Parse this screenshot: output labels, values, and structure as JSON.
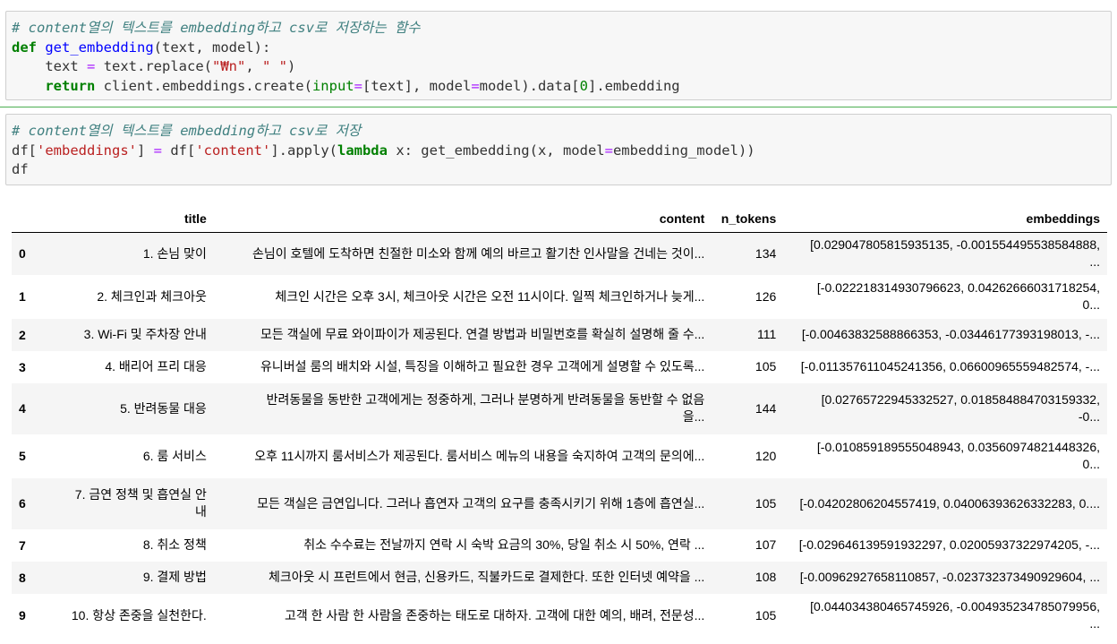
{
  "cells": {
    "cell1": {
      "comment": "# content열의 텍스트를 embedding하고 csv로 저장하는 함수",
      "def_kw": "def",
      "func_name": "get_embedding",
      "def_params": "(text, model):",
      "line2_var": "text",
      "line2_eq": "=",
      "line2_expr": "text.replace(",
      "line2_s1": "\"₩n\"",
      "line2_sep": ", ",
      "line2_s2": "\" \"",
      "line2_end": ")",
      "return_kw": "return",
      "line3_a": "client.embeddings.create(",
      "line3_kw_input": "input",
      "line3_eq1": "=",
      "line3_b": "[text], model",
      "line3_eq2": "=",
      "line3_c": "model).data[",
      "line3_zero": "0",
      "line3_d": "].embedding"
    },
    "cell2": {
      "comment": "# content열의 텍스트를 embedding하고 csv로 저장",
      "l2_a": "df[",
      "l2_s1": "'embeddings'",
      "l2_b": "] ",
      "l2_eq": "=",
      "l2_c": " df[",
      "l2_s2": "'content'",
      "l2_d": "].apply(",
      "l2_lambda": "lambda",
      "l2_e": " x: get_embedding(x, model",
      "l2_eq2": "=",
      "l2_f": "embedding_model))",
      "l3": "df"
    }
  },
  "table": {
    "columns": [
      "title",
      "content",
      "n_tokens",
      "embeddings"
    ],
    "rows": [
      {
        "idx": "0",
        "title": "1. 손님 맞이",
        "content": "손님이 호텔에 도착하면 친절한 미소와 함께 예의 바르고 활기찬 인사말을 건네는 것이...",
        "n_tokens": "134",
        "emb1": "[0.029047805815935135, -0.001554495538584888,",
        "emb2": "..."
      },
      {
        "idx": "1",
        "title": "2. 체크인과 체크아웃",
        "content": "체크인 시간은 오후 3시, 체크아웃 시간은 오전 11시이다. 일찍 체크인하거나 늦게...",
        "n_tokens": "126",
        "emb1": "[-0.022218314930796623, 0.04262666031718254,",
        "emb2": "0..."
      },
      {
        "idx": "2",
        "title": "3. Wi-Fi 및 주차장 안내",
        "content": "모든 객실에 무료 와이파이가 제공된다. 연결 방법과 비밀번호를 확실히 설명해 줄 수...",
        "n_tokens": "111",
        "emb1": "[-0.00463832588866353, -0.03446177393198013, -...",
        "emb2": ""
      },
      {
        "idx": "3",
        "title": "4. 배리어 프리 대응",
        "content": "유니버설 룸의 배치와 시설, 특징을 이해하고 필요한 경우 고객에게 설명할 수 있도록...",
        "n_tokens": "105",
        "emb1": "[-0.011357611045241356, 0.06600965559482574, -...",
        "emb2": ""
      },
      {
        "idx": "4",
        "title": "5. 반려동물 대응",
        "content": "반려동물을 동반한 고객에게는 정중하게, 그러나 분명하게 반려동물을 동반할 수 없음",
        "content2": "을...",
        "n_tokens": "144",
        "emb1": "[0.02765722945332527, 0.018584884703159332,",
        "emb2": "-0..."
      },
      {
        "idx": "5",
        "title": "6. 룸 서비스",
        "content": "오후 11시까지 룸서비스가 제공된다. 룸서비스 메뉴의 내용을 숙지하여 고객의 문의에...",
        "n_tokens": "120",
        "emb1": "[-0.010859189555048943, 0.03560974821448326,",
        "emb2": "0..."
      },
      {
        "idx": "6",
        "title": "7. 금연 정책 및 흡연실 안",
        "title2": "내",
        "content": "모든 객실은 금연입니다. 그러나 흡연자 고객의 요구를 충족시키기 위해 1층에 흡연실...",
        "n_tokens": "105",
        "emb1": "[-0.04202806204557419, 0.04006393626332283, 0....",
        "emb2": ""
      },
      {
        "idx": "7",
        "title": "8. 취소 정책",
        "content": "취소 수수료는 전날까지 연락 시 숙박 요금의 30%, 당일 취소 시 50%, 연락 ...",
        "n_tokens": "107",
        "emb1": "[-0.029646139591932297, 0.02005937322974205, -...",
        "emb2": ""
      },
      {
        "idx": "8",
        "title": "9. 결제 방법",
        "content": "체크아웃 시 프런트에서 현금, 신용카드, 직불카드로 결제한다. 또한 인터넷 예약을 ...",
        "n_tokens": "108",
        "emb1": "[-0.00962927658110857, -0.023732373490929604, ...",
        "emb2": ""
      },
      {
        "idx": "9",
        "title": "10. 항상 존중을 실천한다.",
        "content": "고객 한 사람 한 사람을 존중하는 태도로 대하자. 고객에 대한 예의, 배려, 전문성...",
        "n_tokens": "105",
        "emb1": "[0.044034380465745926, -0.004935234785079956,",
        "emb2": "..."
      }
    ]
  }
}
